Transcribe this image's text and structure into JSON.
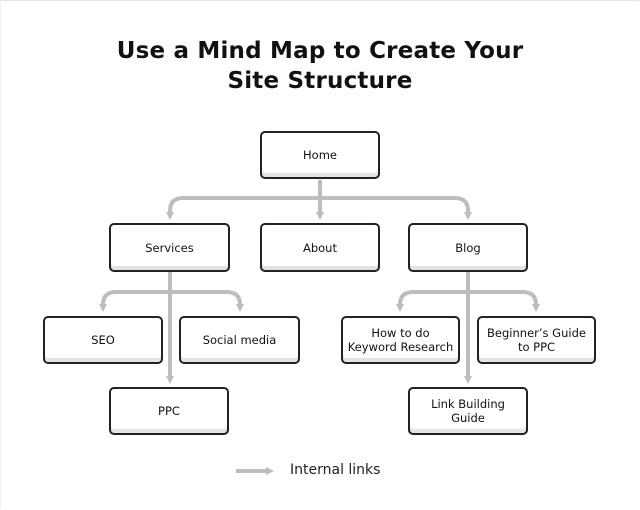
{
  "title_line1": "Use a Mind Map to Create Your",
  "title_line2": "Site Structure",
  "link_color": "#bdbdbd",
  "nodes": {
    "home": "Home",
    "services": "Services",
    "about": "About",
    "blog": "Blog",
    "seo": "SEO",
    "social_media": "Social media",
    "ppc": "PPC",
    "keyword_research_1": "How to do",
    "keyword_research_2": "Keyword Research",
    "beginners_guide_1": "Beginner’s Guide",
    "beginners_guide_2": "to PPC",
    "link_building_1": "Link Building",
    "link_building_2": "Guide"
  },
  "edges": [
    [
      "Home",
      "Services"
    ],
    [
      "Home",
      "About"
    ],
    [
      "Home",
      "Blog"
    ],
    [
      "Services",
      "SEO"
    ],
    [
      "Services",
      "Social media"
    ],
    [
      "Services",
      "PPC"
    ],
    [
      "Blog",
      "How to do Keyword Research"
    ],
    [
      "Blog",
      "Beginner’s Guide to PPC"
    ],
    [
      "Blog",
      "Link Building Guide"
    ]
  ],
  "legend": {
    "label": "Internal links",
    "icon": "arrow-right-icon"
  }
}
